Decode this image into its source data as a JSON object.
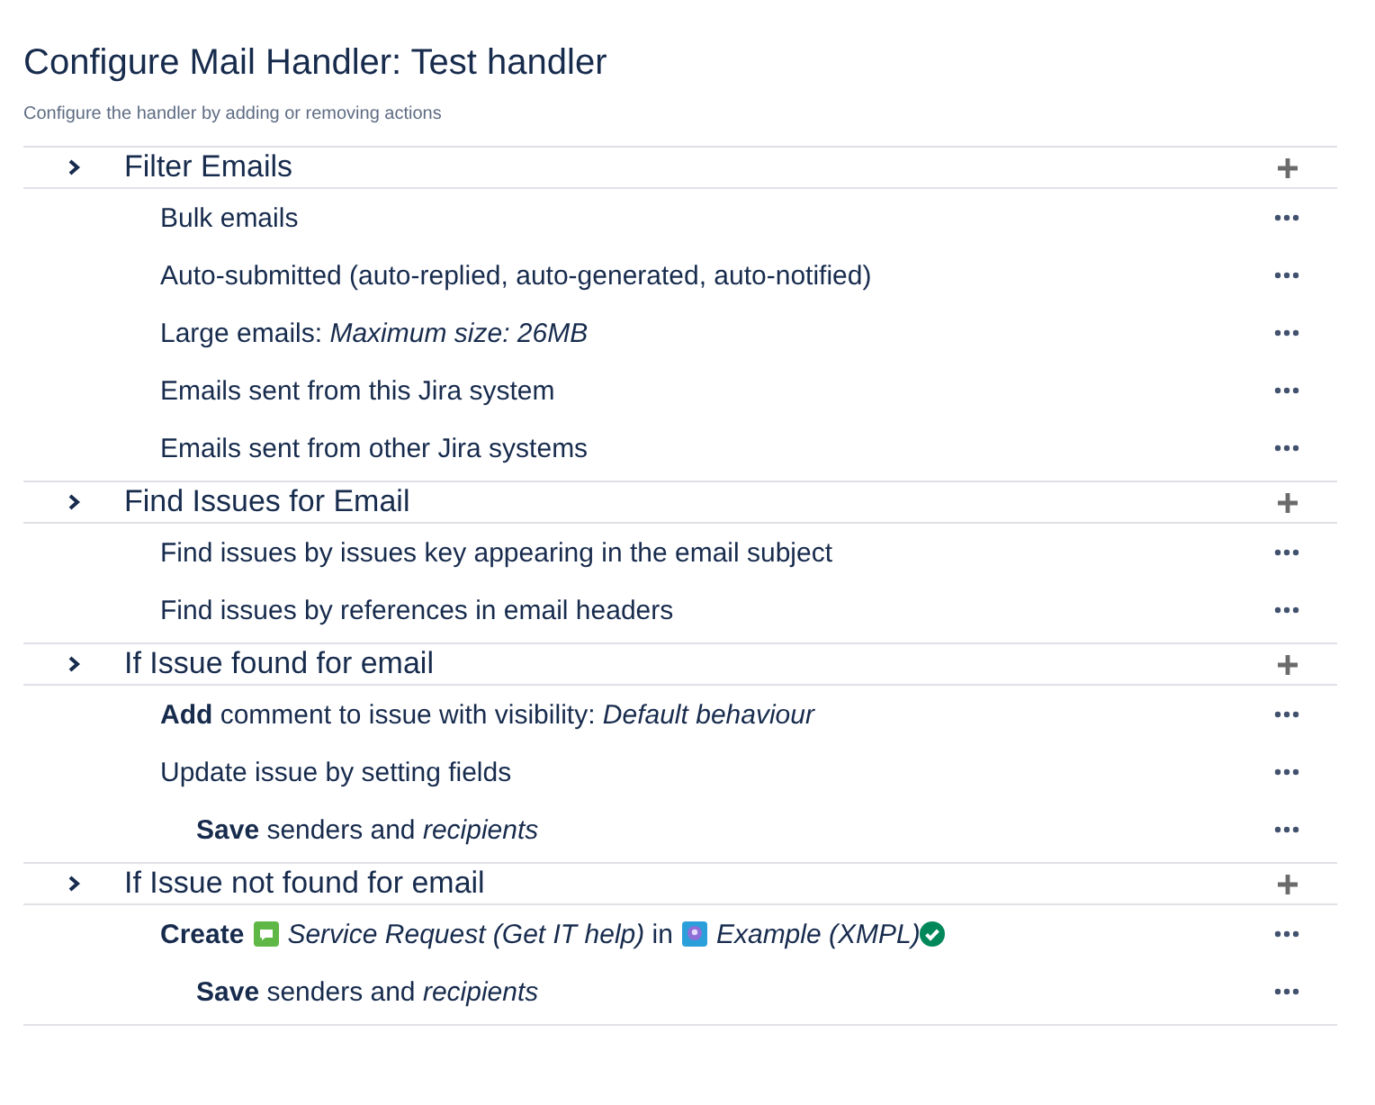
{
  "title": "Configure Mail Handler: Test handler",
  "subtitle": "Configure the handler by adding or removing actions",
  "sections": [
    {
      "title": "Filter Emails",
      "expanded": false,
      "actions": [
        {
          "parts": [
            {
              "kind": "text",
              "text": "Bulk emails"
            }
          ]
        },
        {
          "parts": [
            {
              "kind": "text",
              "text": "Auto-submitted (auto-replied, auto-generated, auto-notified)"
            }
          ]
        },
        {
          "parts": [
            {
              "kind": "text",
              "text": "Large emails: *Maximum size: 26MB*"
            }
          ]
        },
        {
          "parts": [
            {
              "kind": "text",
              "text": "Emails sent from this Jira system"
            }
          ]
        },
        {
          "parts": [
            {
              "kind": "text",
              "text": "Emails sent from other Jira systems"
            }
          ]
        }
      ]
    },
    {
      "title": "Find Issues for Email",
      "expanded": false,
      "actions": [
        {
          "parts": [
            {
              "kind": "text",
              "text": "Find issues by issues key appearing in the email subject"
            }
          ]
        },
        {
          "parts": [
            {
              "kind": "text",
              "text": "Find issues by references in email headers"
            }
          ]
        }
      ]
    },
    {
      "title": "If Issue found for email",
      "expanded": false,
      "actions": [
        {
          "parts": [
            {
              "kind": "text",
              "text": "**Add** comment to issue with visibility: *Default behaviour*"
            }
          ]
        },
        {
          "parts": [
            {
              "kind": "text",
              "text": "Update issue by setting fields"
            }
          ],
          "children": [
            {
              "parts": [
                {
                  "kind": "text",
                  "text": "**Save** senders and *recipients*"
                }
              ]
            }
          ]
        }
      ]
    },
    {
      "title": "If Issue not found for email",
      "expanded": false,
      "actions": [
        {
          "parts": [
            {
              "kind": "text",
              "text": "**Create**"
            },
            {
              "kind": "type"
            },
            {
              "kind": "text",
              "text": "*Service Request (Get IT help)* in"
            },
            {
              "kind": "project"
            },
            {
              "kind": "text",
              "text": "*Example (XMPL)*"
            },
            {
              "kind": "verified"
            }
          ],
          "children": [
            {
              "parts": [
                {
                  "kind": "text",
                  "text": "**Save** senders and *recipients*"
                }
              ]
            }
          ]
        }
      ]
    }
  ]
}
